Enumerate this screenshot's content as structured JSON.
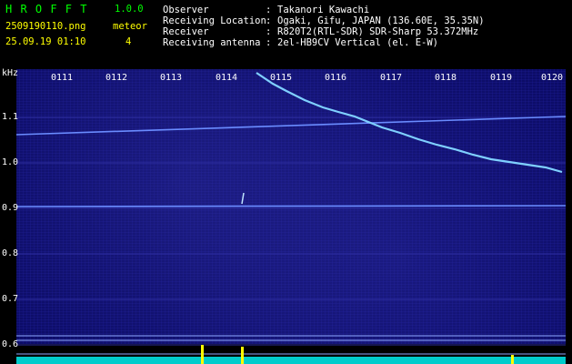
{
  "header": {
    "app_name": "H R O F F T",
    "version": "1.0.0",
    "filename": "2509190110.png",
    "detection_label": "meteor",
    "datetime": "25.09.19 01:10",
    "meteor_count": "4",
    "info_rows": [
      {
        "key": "Observer",
        "value": "Takanori Kawachi"
      },
      {
        "key": "Receiving Location",
        "value": "Ogaki, Gifu, JAPAN (136.60E, 35.35N)"
      },
      {
        "key": "Receiver",
        "value": "R820T2(RTL-SDR) SDR-Sharp 53.372MHz"
      },
      {
        "key": "Receiving antenna",
        "value": "2el-HB9CV Vertical (el. E-W)"
      }
    ]
  },
  "axis": {
    "unit": "kHz",
    "y_ticks": [
      "1.1",
      "1.0",
      "0.9",
      "0.8",
      "0.7",
      "0.6"
    ],
    "x_ticks": [
      "0111",
      "0112",
      "0113",
      "0114",
      "0115",
      "0116",
      "0117",
      "0118",
      "0119",
      "0120"
    ]
  },
  "colors": {
    "background": "#000000",
    "waterfall": "#0a0a64",
    "grid": "#2d2da0",
    "signal": "#7fd0ff",
    "carrier": "#6a8cff",
    "title_green": "#00ff00",
    "count_yellow": "#ffff00",
    "level_cyan": "#00ffff"
  }
}
